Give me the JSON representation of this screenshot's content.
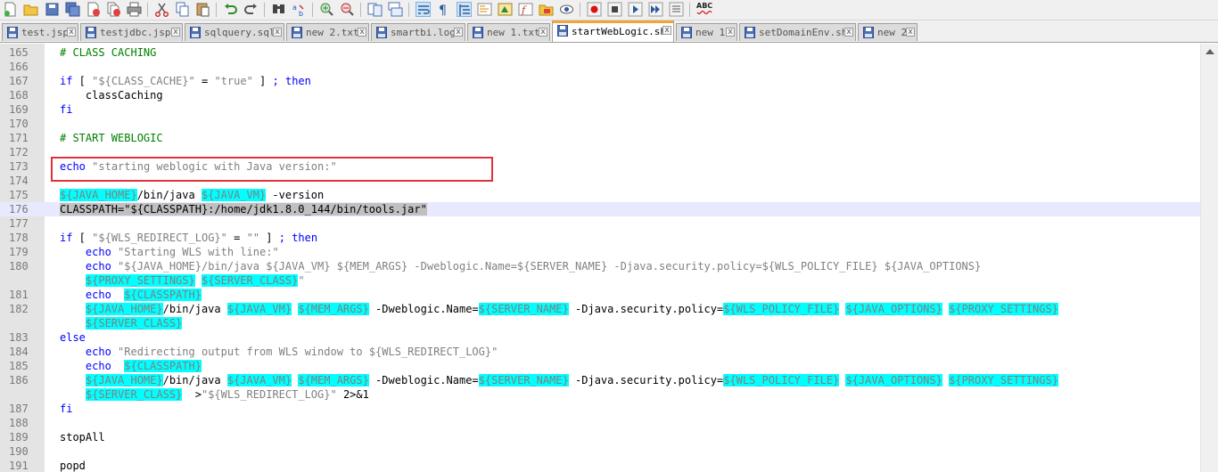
{
  "toolbar": {
    "icons": [
      "new-file-icon",
      "open-file-icon",
      "save-icon",
      "save-all-icon",
      "close-icon",
      "close-all-icon",
      "print-icon",
      "cut-icon",
      "copy-icon",
      "paste-icon",
      "undo-icon",
      "redo-icon",
      "find-icon",
      "replace-icon",
      "zoom-in-icon",
      "zoom-out-icon",
      "sync-vertical-icon",
      "sync-horizontal-icon",
      "word-wrap-icon",
      "show-all-chars-icon",
      "indent-guide-icon",
      "user-defined-language-icon",
      "document-map-icon",
      "function-list-icon",
      "folder-as-workspace-icon",
      "monitoring-icon",
      "record-macro-icon",
      "stop-recording-icon",
      "playback-macro-icon",
      "run-macro-multiple-icon",
      "save-macro-icon",
      "spell-check-icon"
    ],
    "spell_check_label": "ABC"
  },
  "tabs": [
    {
      "label": "test.jsp",
      "active": false
    },
    {
      "label": "testjdbc.jsp",
      "active": false
    },
    {
      "label": "sqlquery.sql",
      "active": false
    },
    {
      "label": "new 2.txt",
      "active": false
    },
    {
      "label": "smartbi.log",
      "active": false
    },
    {
      "label": "new 1.txt",
      "active": false
    },
    {
      "label": "startWebLogic.sh",
      "active": true
    },
    {
      "label": "new 1",
      "active": false
    },
    {
      "label": "setDomainEnv.sh",
      "active": false
    },
    {
      "label": "new 2",
      "active": false
    }
  ],
  "tab_close_glyph": "x",
  "editor": {
    "lines": [
      {
        "num": "165",
        "text": "# CLASS CACHING"
      },
      {
        "num": "166",
        "text": ""
      },
      {
        "num": "167",
        "text": "if [ \"${CLASS_CACHE}\" = \"true\" ] ; then"
      },
      {
        "num": "168",
        "text": "    classCaching"
      },
      {
        "num": "169",
        "text": "fi"
      },
      {
        "num": "170",
        "text": ""
      },
      {
        "num": "171",
        "text": "# START WEBLOGIC"
      },
      {
        "num": "172",
        "text": ""
      },
      {
        "num": "173",
        "text": "echo \"starting weblogic with Java version:\""
      },
      {
        "num": "174",
        "text": ""
      },
      {
        "num": "175",
        "text": "${JAVA_HOME}/bin/java ${JAVA_VM} -version"
      },
      {
        "num": "176",
        "text": "CLASSPATH=\"${CLASSPATH}:/home/jdk1.8.0_144/bin/tools.jar\""
      },
      {
        "num": "177",
        "text": ""
      },
      {
        "num": "178",
        "text": "if [ \"${WLS_REDIRECT_LOG}\" = \"\" ] ; then"
      },
      {
        "num": "179",
        "text": "    echo \"Starting WLS with line:\""
      },
      {
        "num": "180",
        "text": "    echo \"${JAVA_HOME}/bin/java ${JAVA_VM} ${MEM_ARGS} -Dweblogic.Name=${SERVER_NAME} -Djava.security.policy=${WLS_POLICY_FILE} ${JAVA_OPTIONS}"
      },
      {
        "num": "",
        "text": "    ${PROXY_SETTINGS} ${SERVER_CLASS}\""
      },
      {
        "num": "181",
        "text": "    echo  ${CLASSPATH}"
      },
      {
        "num": "182",
        "text": "    ${JAVA_HOME}/bin/java ${JAVA_VM} ${MEM_ARGS} -Dweblogic.Name=${SERVER_NAME} -Djava.security.policy=${WLS_POLICY_FILE} ${JAVA_OPTIONS} ${PROXY_SETTINGS}"
      },
      {
        "num": "",
        "text": "    ${SERVER_CLASS}"
      },
      {
        "num": "183",
        "text": "else"
      },
      {
        "num": "184",
        "text": "    echo \"Redirecting output from WLS window to ${WLS_REDIRECT_LOG}\""
      },
      {
        "num": "185",
        "text": "    echo  ${CLASSPATH}"
      },
      {
        "num": "186",
        "text": "    ${JAVA_HOME}/bin/java ${JAVA_VM} ${MEM_ARGS} -Dweblogic.Name=${SERVER_NAME} -Djava.security.policy=${WLS_POLICY_FILE} ${JAVA_OPTIONS} ${PROXY_SETTINGS}"
      },
      {
        "num": "",
        "text": "    ${SERVER_CLASS}  >\"${WLS_REDIRECT_LOG}\" 2>&1"
      },
      {
        "num": "187",
        "text": "fi"
      },
      {
        "num": "188",
        "text": ""
      },
      {
        "num": "189",
        "text": "stopAll"
      },
      {
        "num": "190",
        "text": ""
      },
      {
        "num": "191",
        "text": "popd"
      }
    ]
  },
  "colors": {
    "keyword": "#0000ff",
    "comment": "#008000",
    "string": "#808080",
    "variable_highlight": "#00ffff",
    "annotation_box": "#e0313b",
    "active_tab_accent": "#f2a33a"
  }
}
